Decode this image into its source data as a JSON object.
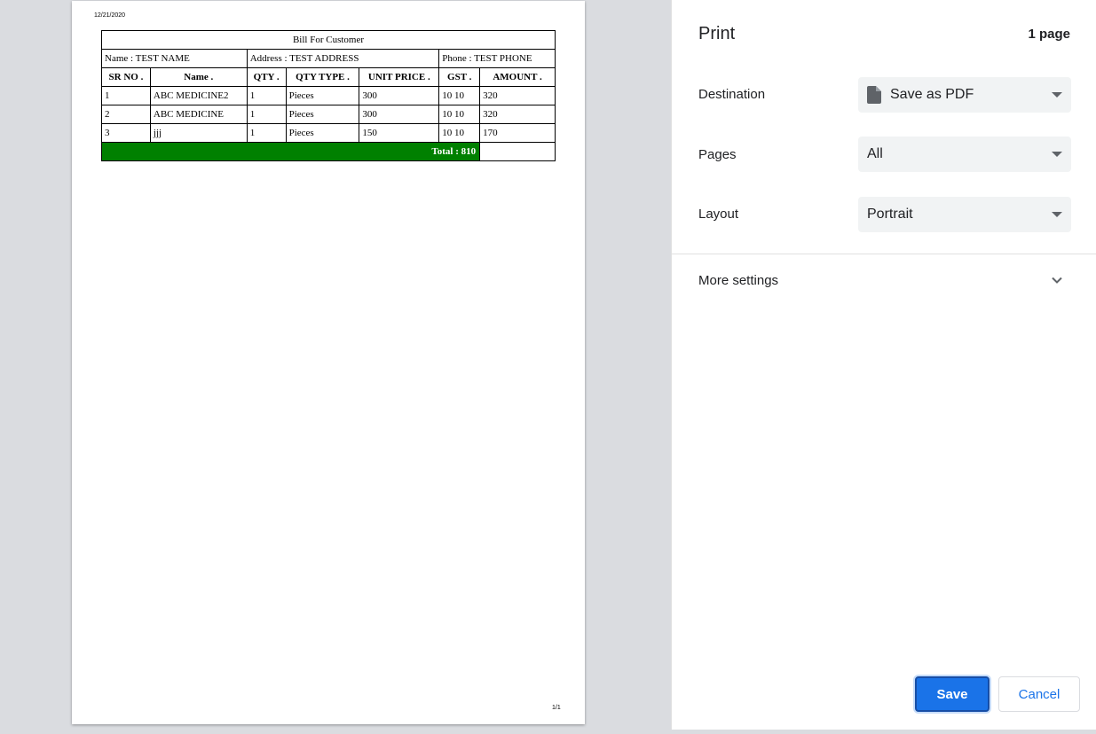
{
  "preview": {
    "date": "12/21/2020",
    "page_number": "1/1",
    "bill": {
      "title": "Bill For Customer",
      "name": "Name : TEST NAME",
      "address": "Address : TEST ADDRESS",
      "phone": "Phone : TEST PHONE",
      "headers": [
        "SR NO .",
        "Name .",
        "QTY .",
        "QTY TYPE .",
        "UNIT PRICE .",
        "GST .",
        "AMOUNT ."
      ],
      "rows": [
        [
          "1",
          "ABC MEDICINE2",
          "1",
          "Pieces",
          "300",
          "10 10",
          "320"
        ],
        [
          "2",
          "ABC MEDICINE",
          "1",
          "Pieces",
          "300",
          "10 10",
          "320"
        ],
        [
          "3",
          "jjj",
          "1",
          "Pieces",
          "150",
          "10 10",
          "170"
        ]
      ],
      "total": "Total : 810",
      "total_color": "#008000"
    }
  },
  "sidebar": {
    "title": "Print",
    "page_count": "1 page",
    "destination": {
      "label": "Destination",
      "value": "Save as PDF",
      "icon": "file-icon"
    },
    "pages": {
      "label": "Pages",
      "value": "All"
    },
    "layout": {
      "label": "Layout",
      "value": "Portrait"
    },
    "more_settings": {
      "label": "More settings",
      "icon": "chevron-down-icon"
    },
    "save_label": "Save",
    "cancel_label": "Cancel",
    "accent_color": "#1a73e8"
  }
}
